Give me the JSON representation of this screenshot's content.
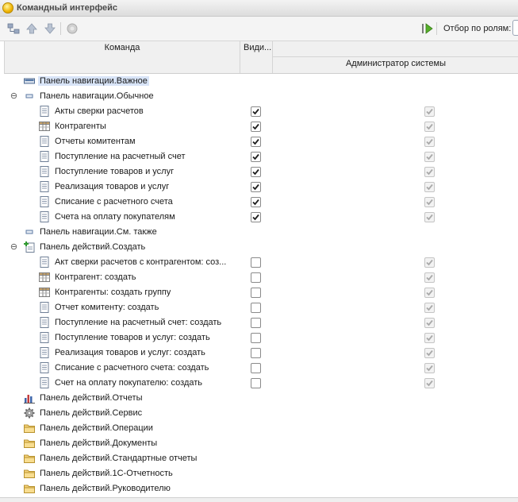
{
  "window": {
    "title": "Командный интерфейс"
  },
  "toolbar": {
    "role_filter_label": "Отбор по ролям:",
    "icons": [
      "tree-structure-icon",
      "arrow-up-icon",
      "arrow-down-icon",
      "disabled-circle-icon",
      "run-arrow-icon"
    ]
  },
  "columns": {
    "command": "Команда",
    "visibility": "Види...",
    "role": "Администратор системы"
  },
  "colors": {
    "selection": "#d8e4f7",
    "header": "#f0f0f0",
    "toolbar": "#f4f4f4"
  },
  "rows": [
    {
      "label": "Панель навигации.Важное",
      "level": 0,
      "icon": "panel-important-icon",
      "selected": true
    },
    {
      "label": "Панель навигации.Обычное",
      "level": 0,
      "icon": "panel-normal-icon",
      "expander": "⊖"
    },
    {
      "label": "Акты сверки расчетов",
      "level": 1,
      "icon": "document-icon",
      "vis": true,
      "role": true
    },
    {
      "label": "Контрагенты",
      "level": 1,
      "icon": "catalog-icon",
      "vis": true,
      "role": true
    },
    {
      "label": "Отчеты комитентам",
      "level": 1,
      "icon": "document-icon",
      "vis": true,
      "role": true
    },
    {
      "label": "Поступление на расчетный счет",
      "level": 1,
      "icon": "document-icon",
      "vis": true,
      "role": true
    },
    {
      "label": "Поступление товаров и услуг",
      "level": 1,
      "icon": "document-icon",
      "vis": true,
      "role": true
    },
    {
      "label": "Реализация товаров и услуг",
      "level": 1,
      "icon": "document-icon",
      "vis": true,
      "role": true
    },
    {
      "label": "Списание с расчетного счета",
      "level": 1,
      "icon": "document-icon",
      "vis": true,
      "role": true
    },
    {
      "label": "Счета на оплату покупателям",
      "level": 1,
      "icon": "document-icon",
      "vis": true,
      "role": true
    },
    {
      "label": "Панель навигации.См. также",
      "level": 0,
      "icon": "panel-normal-icon"
    },
    {
      "label": "Панель действий.Создать",
      "level": 0,
      "icon": "create-plus-icon",
      "expander": "⊖"
    },
    {
      "label": "Акт сверки расчетов с контрагентом: соз...",
      "level": 1,
      "icon": "document-icon",
      "vis": false,
      "role": true
    },
    {
      "label": "Контрагент: создать",
      "level": 1,
      "icon": "catalog-icon",
      "vis": false,
      "role": true
    },
    {
      "label": "Контрагенты: создать группу",
      "level": 1,
      "icon": "catalog-icon",
      "vis": false,
      "role": true
    },
    {
      "label": "Отчет комитенту: создать",
      "level": 1,
      "icon": "document-icon",
      "vis": false,
      "role": true
    },
    {
      "label": "Поступление на расчетный счет: создать",
      "level": 1,
      "icon": "document-icon",
      "vis": false,
      "role": true
    },
    {
      "label": "Поступление товаров и услуг: создать",
      "level": 1,
      "icon": "document-icon",
      "vis": false,
      "role": true
    },
    {
      "label": "Реализация товаров и услуг: создать",
      "level": 1,
      "icon": "document-icon",
      "vis": false,
      "role": true
    },
    {
      "label": "Списание с расчетного счета: создать",
      "level": 1,
      "icon": "document-icon",
      "vis": false,
      "role": true
    },
    {
      "label": "Счет на оплату покупателю: создать",
      "level": 1,
      "icon": "document-icon",
      "vis": false,
      "role": true
    },
    {
      "label": "Панель действий.Отчеты",
      "level": 0,
      "icon": "reports-chart-icon"
    },
    {
      "label": "Панель действий.Сервис",
      "level": 0,
      "icon": "service-gear-icon"
    },
    {
      "label": "Панель действий.Операции",
      "level": 0,
      "icon": "folder-icon"
    },
    {
      "label": "Панель действий.Документы",
      "level": 0,
      "icon": "folder-icon"
    },
    {
      "label": "Панель действий.Стандартные отчеты",
      "level": 0,
      "icon": "folder-icon"
    },
    {
      "label": "Панель действий.1С-Отчетность",
      "level": 0,
      "icon": "folder-icon"
    },
    {
      "label": "Панель действий.Руководителю",
      "level": 0,
      "icon": "folder-icon"
    }
  ]
}
